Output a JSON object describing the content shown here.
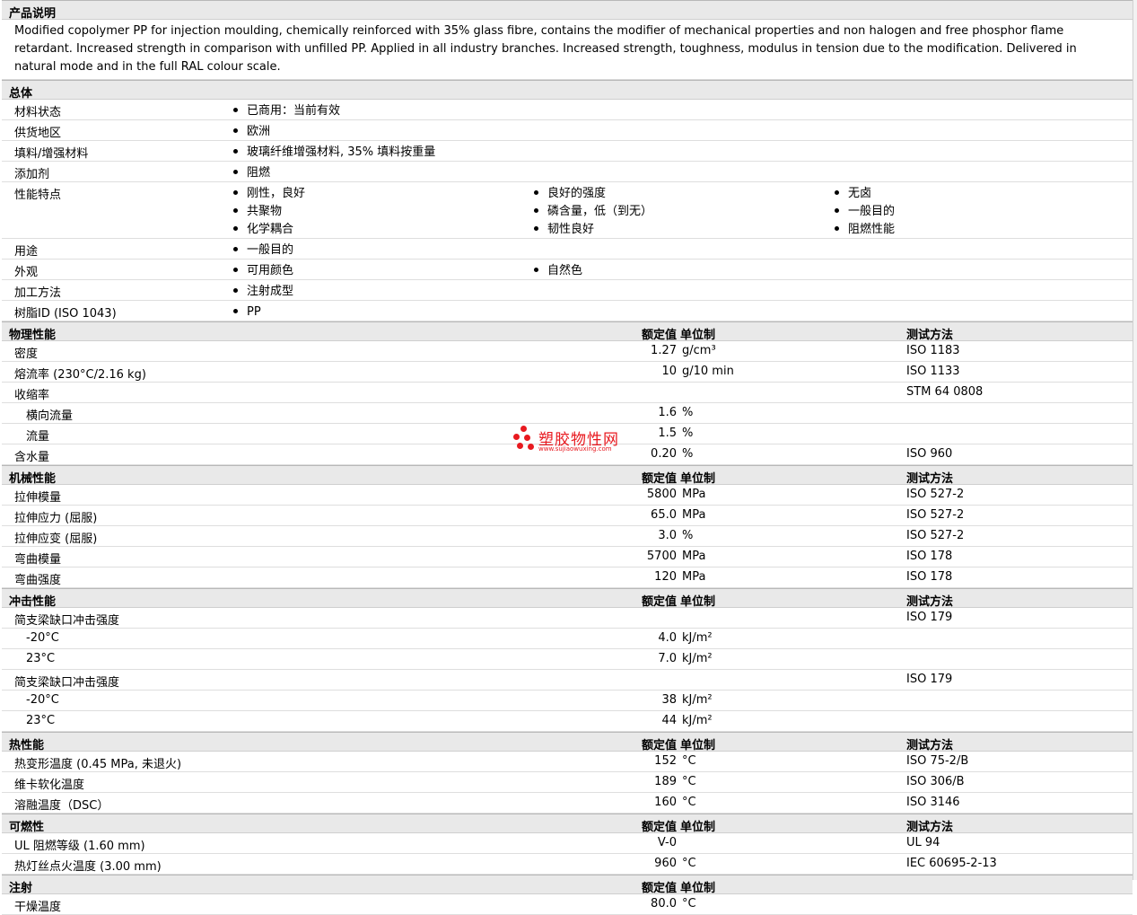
{
  "desc_section": "产品说明",
  "description": "Modified copolymer PP for injection moulding, chemically reinforced with 35% glass fibre, contains the modifier of mechanical properties and non halogen and free phosphor flame retardant. Increased strength in comparison with unfilled PP. Applied in all industry branches. Increased strength, toughness, modulus in tension due to the modification. Delivered in natural mode and in the full RAL colour scale.",
  "general": {
    "title": "总体",
    "rows": [
      {
        "label": "材料状态",
        "cols": [
          [
            "已商用：当前有效"
          ]
        ]
      },
      {
        "label": "供货地区",
        "cols": [
          [
            "欧洲"
          ]
        ]
      },
      {
        "label": "填料/增强材料",
        "cols": [
          [
            "玻璃纤维增强材料, 35% 填料按重量"
          ]
        ]
      },
      {
        "label": "添加剂",
        "cols": [
          [
            "阻燃"
          ]
        ]
      },
      {
        "label": "性能特点",
        "cols": [
          [
            "刚性，良好",
            "共聚物",
            "化学耦合"
          ],
          [
            "良好的强度",
            "磷含量，低（到无）",
            "韧性良好"
          ],
          [
            "无卤",
            "一般目的",
            "阻燃性能"
          ]
        ]
      },
      {
        "label": "用途",
        "cols": [
          [
            "一般目的"
          ]
        ]
      },
      {
        "label": "外观",
        "cols": [
          [
            "可用颜色"
          ],
          [
            "自然色"
          ]
        ]
      },
      {
        "label": "加工方法",
        "cols": [
          [
            "注射成型"
          ]
        ]
      },
      {
        "label": "树脂ID (ISO 1043)",
        "cols": [
          [
            "PP"
          ]
        ]
      }
    ]
  },
  "headers": {
    "value": "额定值",
    "unit": "单位制",
    "method": "测试方法"
  },
  "sections": [
    {
      "title": "物理性能",
      "show_method": true,
      "rows": [
        {
          "label": "密度",
          "value": "1.27",
          "unit": "g/cm³",
          "method": "ISO 1183"
        },
        {
          "label": "熔流率 (230°C/2.16 kg)",
          "value": "10",
          "unit": "g/10 min",
          "method": "ISO 1133"
        },
        {
          "label": "收缩率",
          "value": "",
          "unit": "",
          "method": "STM 64 0808"
        },
        {
          "label": "横向流量",
          "sub": true,
          "value": "1.6",
          "unit": "%",
          "method": ""
        },
        {
          "label": "流量",
          "sub": true,
          "value": "1.5",
          "unit": "%",
          "method": ""
        },
        {
          "label": "含水量",
          "value": "0.20",
          "unit": "%",
          "method": "ISO 960"
        }
      ]
    },
    {
      "title": "机械性能",
      "show_method": true,
      "rows": [
        {
          "label": "拉伸模量",
          "value": "5800",
          "unit": "MPa",
          "method": "ISO 527-2"
        },
        {
          "label": "拉伸应力 (屈服)",
          "value": "65.0",
          "unit": "MPa",
          "method": "ISO 527-2"
        },
        {
          "label": "拉伸应变 (屈服)",
          "value": "3.0",
          "unit": "%",
          "method": "ISO 527-2"
        },
        {
          "label": "弯曲模量",
          "value": "5700",
          "unit": "MPa",
          "method": "ISO 178"
        },
        {
          "label": "弯曲强度",
          "value": "120",
          "unit": "MPa",
          "method": "ISO 178"
        }
      ]
    },
    {
      "title": "冲击性能",
      "show_method": true,
      "rows": [
        {
          "label": "简支梁缺口冲击强度",
          "value": "",
          "unit": "",
          "method": "ISO 179"
        },
        {
          "label": "-20°C",
          "sub": true,
          "value": "4.0",
          "unit": "kJ/m²",
          "method": ""
        },
        {
          "label": "23°C",
          "sub": true,
          "value": "7.0",
          "unit": "kJ/m²",
          "method": ""
        },
        {
          "label": "简支梁缺口冲击强度",
          "value": "",
          "unit": "",
          "method": "ISO 179"
        },
        {
          "label": "-20°C",
          "sub": true,
          "value": "38",
          "unit": "kJ/m²",
          "method": ""
        },
        {
          "label": "23°C",
          "sub": true,
          "value": "44",
          "unit": "kJ/m²",
          "method": ""
        }
      ]
    },
    {
      "title": "热性能",
      "show_method": true,
      "rows": [
        {
          "label": "热变形温度 (0.45 MPa, 未退火)",
          "value": "152",
          "unit": "°C",
          "method": "ISO 75-2/B"
        },
        {
          "label": "维卡软化温度",
          "value": "189",
          "unit": "°C",
          "method": "ISO 306/B"
        },
        {
          "label": "溶融温度（DSC）",
          "value": "160",
          "unit": "°C",
          "method": "ISO 3146"
        }
      ]
    },
    {
      "title": "可燃性",
      "show_method": true,
      "rows": [
        {
          "label": "UL 阻燃等级 (1.60 mm)",
          "value": "V-0",
          "unit": "",
          "method": "UL 94"
        },
        {
          "label": "热灯丝点火温度 (3.00 mm)",
          "value": "960",
          "unit": "°C",
          "method": "IEC 60695-2-13"
        }
      ]
    },
    {
      "title": "注射",
      "show_method": false,
      "rows": [
        {
          "label": "干燥温度",
          "value": "80.0",
          "unit": "°C",
          "method": ""
        }
      ]
    }
  ],
  "watermark": {
    "text": "塑胶物性网",
    "url": "www.sujiaowuxing.com",
    "color": "#e8191f"
  }
}
